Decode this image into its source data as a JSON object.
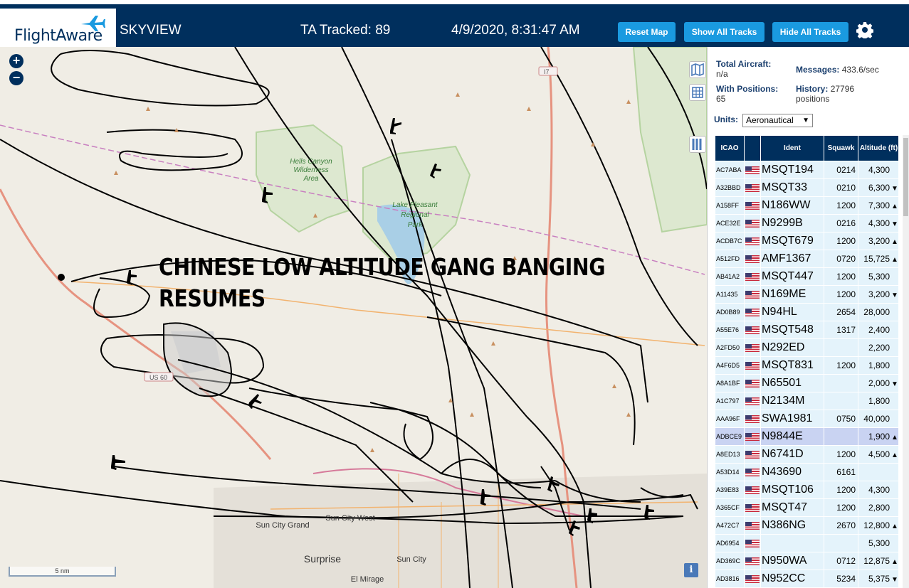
{
  "header": {
    "logo_text": "FlightAware",
    "app_name": "SKYVIEW",
    "tracked": "TA Tracked: 89",
    "datetime": "4/9/2020, 8:31:47 AM",
    "reset_label": "Reset Map",
    "show_label": "Show All Tracks",
    "hide_label": "Hide All Tracks",
    "settings_icon": "gear-icon"
  },
  "map": {
    "overlay_line1": "CHINESE LOW ALTITUDE GANG BANGING",
    "overlay_line2": "RESUMES",
    "zoom_in": "+",
    "zoom_out": "−",
    "scale_label": "5 nm",
    "info_label": "i",
    "labels": {
      "hells_canyon": "Hells Canyon",
      "wilderness": "Wilderness",
      "area": "Area",
      "lake": "Lake Pleasant",
      "regional": "Regional",
      "park": "Park",
      "sun_city_grand": "Sun City Grand",
      "sun_city_west": "Sun City West",
      "surprise": "Surprise",
      "sun_city": "Sun City",
      "el_mirage": "El Mirage",
      "i17": "I7",
      "us60": "US 60"
    }
  },
  "stats": {
    "total_label": "Total Aircraft:",
    "total_value": "n/a",
    "positions_label": "With Positions:",
    "positions_value": "65",
    "messages_label": "Messages:",
    "messages_value": "433.6/sec",
    "history_label": "History:",
    "history_value": "27796",
    "history_unit": "positions",
    "units_label": "Units:",
    "units_value": "Aeronautical"
  },
  "table": {
    "headers": {
      "icao": "ICAO",
      "ident": "Ident",
      "squawk": "Squawk",
      "altitude": "Altitude (ft)"
    },
    "rows": [
      {
        "icao": "AC7ABA",
        "ident": "MSQT194",
        "squawk": "0214",
        "alt": "4,300",
        "trend": ""
      },
      {
        "icao": "A32BBD",
        "ident": "MSQT33",
        "squawk": "0210",
        "alt": "6,300",
        "trend": "▼"
      },
      {
        "icao": "A158FF",
        "ident": "N186WW",
        "squawk": "1200",
        "alt": "7,300",
        "trend": "▲"
      },
      {
        "icao": "ACE32E",
        "ident": "N9299B",
        "squawk": "0216",
        "alt": "4,300",
        "trend": "▼"
      },
      {
        "icao": "ACDB7C",
        "ident": "MSQT679",
        "squawk": "1200",
        "alt": "3,200",
        "trend": "▲"
      },
      {
        "icao": "A512FD",
        "ident": "AMF1367",
        "squawk": "0720",
        "alt": "15,725",
        "trend": "▲"
      },
      {
        "icao": "AB41A2",
        "ident": "MSQT447",
        "squawk": "1200",
        "alt": "5,300",
        "trend": ""
      },
      {
        "icao": "A11435",
        "ident": "N169ME",
        "squawk": "1200",
        "alt": "3,200",
        "trend": "▼"
      },
      {
        "icao": "AD0B89",
        "ident": "N94HL",
        "squawk": "2654",
        "alt": "28,000",
        "trend": ""
      },
      {
        "icao": "A55E76",
        "ident": "MSQT548",
        "squawk": "1317",
        "alt": "2,400",
        "trend": ""
      },
      {
        "icao": "A2FD50",
        "ident": "N292ED",
        "squawk": "",
        "alt": "2,200",
        "trend": ""
      },
      {
        "icao": "A4F6D5",
        "ident": "MSQT831",
        "squawk": "1200",
        "alt": "1,800",
        "trend": ""
      },
      {
        "icao": "A8A1BF",
        "ident": "N65501",
        "squawk": "",
        "alt": "2,000",
        "trend": "▼"
      },
      {
        "icao": "A1C797",
        "ident": "N2134M",
        "squawk": "",
        "alt": "1,800",
        "trend": ""
      },
      {
        "icao": "AAA96F",
        "ident": "SWA1981",
        "squawk": "0750",
        "alt": "40,000",
        "trend": ""
      },
      {
        "icao": "ADBCE9",
        "ident": "N9844E",
        "squawk": "",
        "alt": "1,900",
        "trend": "▲",
        "selected": true
      },
      {
        "icao": "A8ED13",
        "ident": "N6741D",
        "squawk": "1200",
        "alt": "4,500",
        "trend": "▲"
      },
      {
        "icao": "A53D14",
        "ident": "N43690",
        "squawk": "6161",
        "alt": "",
        "trend": ""
      },
      {
        "icao": "A39E83",
        "ident": "MSQT106",
        "squawk": "1200",
        "alt": "4,300",
        "trend": ""
      },
      {
        "icao": "A365CF",
        "ident": "MSQT47",
        "squawk": "1200",
        "alt": "2,800",
        "trend": ""
      },
      {
        "icao": "A472C7",
        "ident": "N386NG",
        "squawk": "2670",
        "alt": "12,800",
        "trend": "▲"
      },
      {
        "icao": "AD6954",
        "ident": "",
        "squawk": "",
        "alt": "5,300",
        "trend": ""
      },
      {
        "icao": "AD369C",
        "ident": "N950WA",
        "squawk": "0712",
        "alt": "12,875",
        "trend": "▲"
      },
      {
        "icao": "AD3816",
        "ident": "N952CC",
        "squawk": "5234",
        "alt": "5,375",
        "trend": "▼"
      }
    ]
  }
}
